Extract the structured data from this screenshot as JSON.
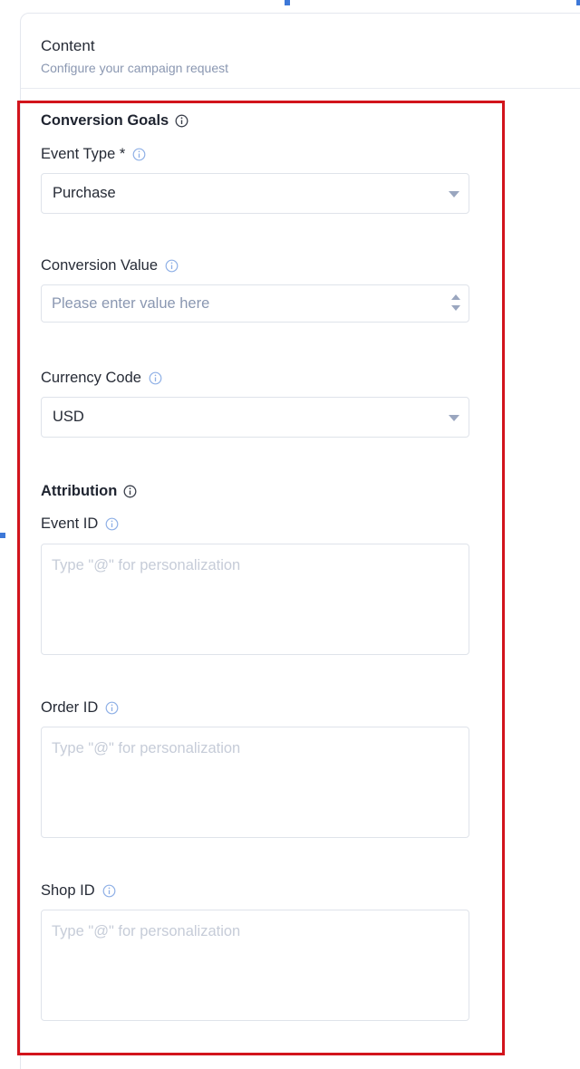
{
  "panel": {
    "title": "Content",
    "subtitle": "Configure your campaign request"
  },
  "conversion_goals": {
    "title": "Conversion Goals",
    "event_type": {
      "label": "Event Type *",
      "value": "Purchase"
    },
    "conversion_value": {
      "label": "Conversion Value",
      "placeholder": "Please enter value here",
      "value": ""
    },
    "currency_code": {
      "label": "Currency Code",
      "value": "USD"
    }
  },
  "attribution": {
    "title": "Attribution",
    "event_id": {
      "label": "Event ID",
      "placeholder": "Type \"@\" for personalization",
      "value": ""
    },
    "order_id": {
      "label": "Order ID",
      "placeholder": "Type \"@\" for personalization",
      "value": ""
    },
    "shop_id": {
      "label": "Shop ID",
      "placeholder": "Type \"@\" for personalization",
      "value": ""
    }
  },
  "colors": {
    "highlight_border": "#d2141c",
    "selection_handle": "#3d78d8",
    "info_icon_dark": "#3a3f4b",
    "info_icon_light": "#8fb0e6",
    "placeholder": "#8a97b1"
  },
  "icons": {
    "section_info": "info-circle-icon",
    "field_info": "info-circle-icon",
    "dropdown": "caret-down-icon",
    "stepper": "stepper-arrows-icon"
  }
}
